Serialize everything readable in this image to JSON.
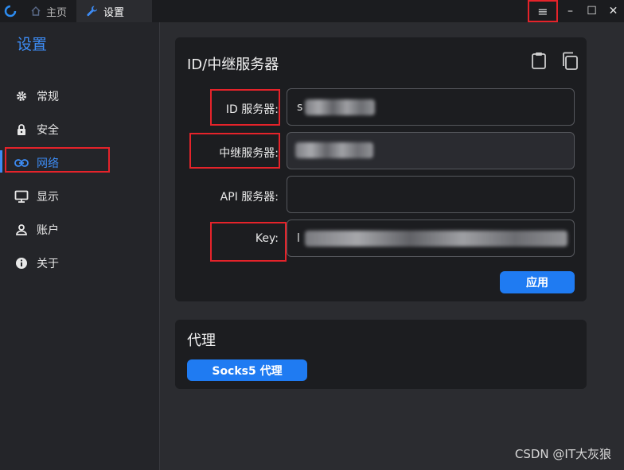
{
  "tabs": [
    {
      "label": "主页",
      "icon": "home-icon"
    },
    {
      "label": "设置",
      "icon": "wrench-icon"
    }
  ],
  "window": {
    "menu_icon": "≡",
    "minimize_icon": "–",
    "maximize_icon": "☐",
    "close_icon": "✕"
  },
  "sidebar": {
    "title": "设置",
    "items": [
      {
        "label": "常规",
        "icon": "gear-icon"
      },
      {
        "label": "安全",
        "icon": "lock-icon"
      },
      {
        "label": "网络",
        "icon": "link-icon"
      },
      {
        "label": "显示",
        "icon": "monitor-icon"
      },
      {
        "label": "账户",
        "icon": "user-icon"
      },
      {
        "label": "关于",
        "icon": "info-icon"
      }
    ],
    "active_index": 2
  },
  "server_card": {
    "title": "ID/中继服务器",
    "fields": [
      {
        "label": "ID 服务器:",
        "value": "s"
      },
      {
        "label": "中继服务器:",
        "value": ""
      },
      {
        "label": "API 服务器:",
        "value": ""
      },
      {
        "label": "Key:",
        "value": "l"
      }
    ],
    "apply_label": "应用"
  },
  "proxy_card": {
    "title": "代理",
    "socks_label": "Socks5 代理"
  },
  "watermark": "CSDN @IT大灰狼",
  "colors": {
    "accent": "#1f7bf2",
    "highlight": "#e5232a",
    "active_text": "#3d8cf5"
  }
}
